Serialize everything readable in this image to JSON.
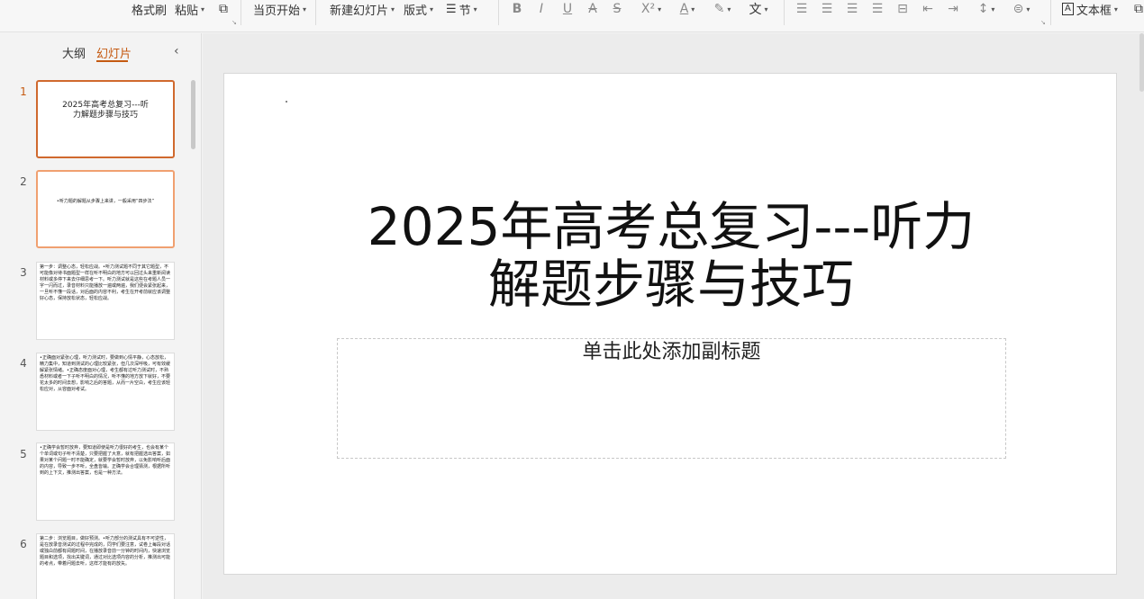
{
  "ribbon": {
    "format_painter": "格式刷",
    "paste": "粘贴",
    "start_from_current": "当页开始",
    "new_slide": "新建幻灯片",
    "layout": "版式",
    "section": "节",
    "text_box": "文本框",
    "icons": {
      "copy": "copy-icon",
      "section": "section-icon",
      "bold": "bold-icon",
      "italic": "italic-icon",
      "underline": "underline-icon",
      "strikethrough": "strikethrough-icon",
      "strike_alt": "strikethrough-s-icon",
      "superscript": "superscript-icon",
      "font_color": "font-color-icon",
      "highlight": "highlight-icon",
      "phonetic": "phonetic-guide-icon",
      "align_left": "align-left-icon",
      "align_center": "align-center-icon",
      "align_right": "align-right-icon",
      "justify": "justify-icon",
      "distribute": "distribute-icon",
      "indent_decrease": "indent-decrease-icon",
      "indent_increase": "indent-increase-icon",
      "line_spacing": "line-spacing-icon",
      "paragraph": "paragraph-icon",
      "text_box": "text-box-icon",
      "more": "more-icon"
    }
  },
  "left_panel": {
    "tab_outline": "大纲",
    "tab_slides": "幻灯片",
    "active_tab": "幻灯片"
  },
  "slides": [
    {
      "num": "1",
      "title": "2025年高考总复习---听力解题步骤与技巧"
    },
    {
      "num": "2",
      "text": "•听力题的解题从步骤上来讲，一般采用“四步法”"
    },
    {
      "num": "3",
      "text": "第一步：调整心态，轻松应战。•听力测试题不同于其它题型，不可能像对待书面题型一样在听不明白的地方可以回过头来重新阅读材料或多停下来去仔细思考一下。听力测试就是这些在考题人员一字一闪而过，录音材料只能播放一遍或两遍，我们便会紧张起来，一旦听不懂一段话，对后面的内容不利，考生在开考前就应该调整好心态，保持放松状态，轻松应战。"
    },
    {
      "num": "4",
      "text": "•正确面对紧张心理，听力测试时，要做到心情平静，心态放松，精力集中，知道到测试的心理比较紧张，但几次深呼吸，可有效缓解紧张情绪。•正确态度面对心理，考生都有过听力测试时，不熟悉材料或者一下子听不明白的情况，听不懂的地方放下就好，不要花太多的时间去想，影响之后的答题，从而一片空白，考生应该轻松应对，从容面对考试。"
    },
    {
      "num": "5",
      "text": "•正确学会暂时放弃，要知道即使是听力很好的考生，也会有某个个单词或句子听不清楚，只要把握了大意，就有把握选出答案，如果对某个问题一时不能确定，就要学会暂时放弃，以免影响听后面的内容，导致一步不听，全盘皆输。正确学会合理猜测，根据所听到的上下文，推测出答案，也是一种方法。"
    },
    {
      "num": "6",
      "text": "第二步：浏览题目，做好预测。•听力部分的测试具有不可逆性，是在放录音测试的过程中完成的，同学们要注意，试卷上每段对话或独白前都有阅题时间，在播放录音前一分钟的时间内，快速浏览题目和选项，找出关键词，通过对比选项内容的分析，推测出可能的考点，带着问题去听，这样才能有的放矢。"
    }
  ],
  "main_slide": {
    "title_line1": "2025年高考总复习---听力",
    "title_line2": "解题步骤与技巧",
    "subtitle_placeholder": "单击此处添加副标题"
  },
  "colors": {
    "accent": "#c55a11",
    "selected_border": "#d0692e",
    "hover_border": "#f0a070"
  }
}
